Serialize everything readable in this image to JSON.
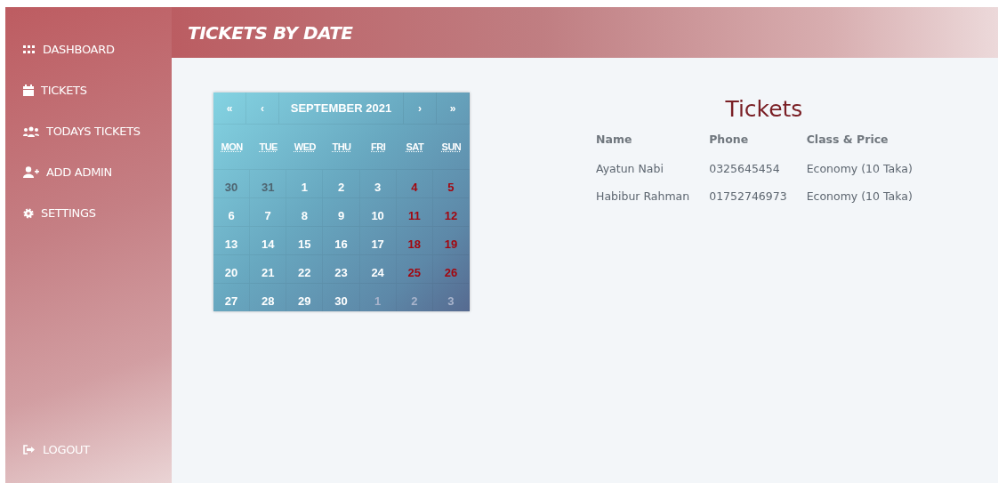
{
  "sidebar": {
    "items": [
      {
        "label": "DASHBOARD"
      },
      {
        "label": "TICKETS"
      },
      {
        "label": "TODAYS TICKETS"
      },
      {
        "label": "ADD ADMIN"
      },
      {
        "label": "SETTINGS"
      }
    ],
    "footer": {
      "label": "LOGOUT"
    }
  },
  "header": {
    "title": "TICKETS BY DATE"
  },
  "calendar": {
    "nav": {
      "first": "«",
      "prev": "‹",
      "label": "SEPTEMBER 2021",
      "next": "›",
      "last": "»"
    },
    "weekdays": [
      "MON",
      "TUE",
      "WED",
      "THU",
      "FRI",
      "SAT",
      "SUN"
    ],
    "weeks": [
      [
        {
          "day": "30",
          "kind": "prev"
        },
        {
          "day": "31",
          "kind": "prev"
        },
        {
          "day": "1",
          "kind": "normal"
        },
        {
          "day": "2",
          "kind": "normal"
        },
        {
          "day": "3",
          "kind": "normal"
        },
        {
          "day": "4",
          "kind": "weekend"
        },
        {
          "day": "5",
          "kind": "weekend"
        }
      ],
      [
        {
          "day": "6",
          "kind": "normal"
        },
        {
          "day": "7",
          "kind": "normal"
        },
        {
          "day": "8",
          "kind": "normal"
        },
        {
          "day": "9",
          "kind": "normal"
        },
        {
          "day": "10",
          "kind": "normal"
        },
        {
          "day": "11",
          "kind": "weekend"
        },
        {
          "day": "12",
          "kind": "weekend"
        }
      ],
      [
        {
          "day": "13",
          "kind": "normal"
        },
        {
          "day": "14",
          "kind": "normal"
        },
        {
          "day": "15",
          "kind": "normal"
        },
        {
          "day": "16",
          "kind": "normal"
        },
        {
          "day": "17",
          "kind": "normal"
        },
        {
          "day": "18",
          "kind": "weekend"
        },
        {
          "day": "19",
          "kind": "weekend"
        }
      ],
      [
        {
          "day": "20",
          "kind": "normal"
        },
        {
          "day": "21",
          "kind": "normal"
        },
        {
          "day": "22",
          "kind": "normal"
        },
        {
          "day": "23",
          "kind": "normal"
        },
        {
          "day": "24",
          "kind": "normal"
        },
        {
          "day": "25",
          "kind": "weekend"
        },
        {
          "day": "26",
          "kind": "weekend"
        }
      ],
      [
        {
          "day": "27",
          "kind": "normal"
        },
        {
          "day": "28",
          "kind": "normal"
        },
        {
          "day": "29",
          "kind": "normal"
        },
        {
          "day": "30",
          "kind": "normal"
        },
        {
          "day": "1",
          "kind": "next"
        },
        {
          "day": "2",
          "kind": "next"
        },
        {
          "day": "3",
          "kind": "next"
        }
      ]
    ]
  },
  "tickets": {
    "title": "Tickets",
    "columns": [
      "Name",
      "Phone",
      "Class & Price"
    ],
    "rows": [
      [
        "Ayatun Nabi",
        "0325645454",
        "Economy (10 Taka)"
      ],
      [
        "Habibur Rahman",
        "01752746973",
        "Economy (10 Taka)"
      ]
    ]
  }
}
